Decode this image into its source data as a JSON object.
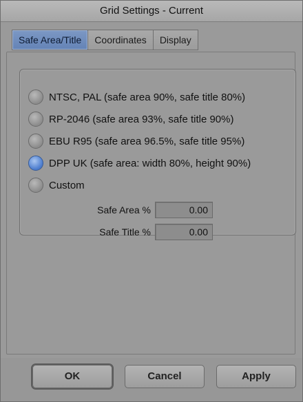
{
  "window": {
    "title": "Grid Settings - Current"
  },
  "tabs": [
    {
      "label": "Safe Area/Title",
      "active": true
    },
    {
      "label": "Coordinates",
      "active": false
    },
    {
      "label": "Display",
      "active": false
    }
  ],
  "options": [
    {
      "label": "NTSC, PAL (safe area 90%, safe title 80%)",
      "selected": false
    },
    {
      "label": "RP-2046 (safe area 93%, safe title 90%)",
      "selected": false
    },
    {
      "label": "EBU R95 (safe area 96.5%, safe title 95%)",
      "selected": false
    },
    {
      "label": "DPP UK (safe area: width 80%, height 90%)",
      "selected": true
    },
    {
      "label": "Custom",
      "selected": false
    }
  ],
  "custom_fields": {
    "safe_area_label": "Safe Area %",
    "safe_area_value": "0.00",
    "safe_title_label": "Safe Title %",
    "safe_title_value": "0.00"
  },
  "buttons": {
    "ok": "OK",
    "cancel": "Cancel",
    "apply": "Apply"
  },
  "colors": {
    "accent_tab": "#6f8cbc",
    "radio_selected": "#4f7fcf",
    "background": "#9a9a9a"
  }
}
